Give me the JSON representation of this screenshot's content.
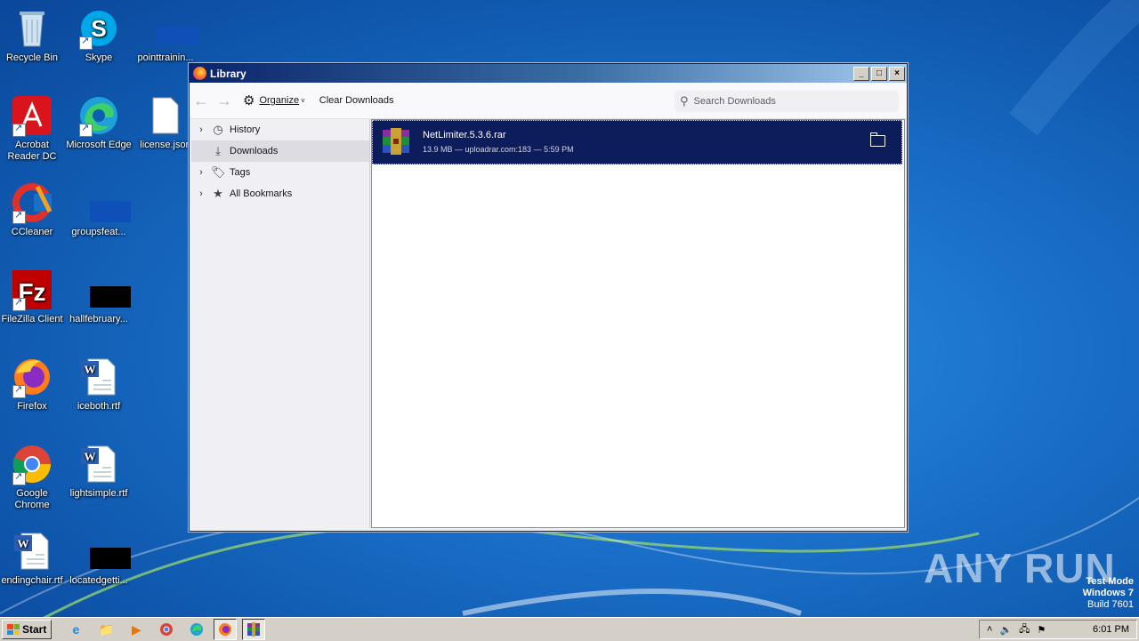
{
  "desktop": {
    "icons": [
      {
        "label": "Recycle Bin"
      },
      {
        "label": "Skype"
      },
      {
        "label": "pointtrainin..."
      },
      {
        "label": "Acrobat Reader DC"
      },
      {
        "label": "Microsoft Edge"
      },
      {
        "label": "license.json"
      },
      {
        "label": "CCleaner"
      },
      {
        "label": "groupsfeat..."
      },
      {
        "label": "FileZilla Client"
      },
      {
        "label": "hallfebruary..."
      },
      {
        "label": "Firefox"
      },
      {
        "label": "iceboth.rtf"
      },
      {
        "label": "Google Chrome"
      },
      {
        "label": "lightsimple.rtf"
      },
      {
        "label": "endingchair.rtf"
      },
      {
        "label": "locatedgetti..."
      }
    ]
  },
  "window": {
    "title": "Library",
    "toolbar": {
      "organize_label": "Organize",
      "clear_label": "Clear Downloads",
      "search_placeholder": "Search Downloads"
    },
    "sidebar": {
      "items": [
        {
          "label": "History",
          "icon": "clock-icon"
        },
        {
          "label": "Downloads",
          "icon": "download-icon"
        },
        {
          "label": "Tags",
          "icon": "tag-icon"
        },
        {
          "label": "All Bookmarks",
          "icon": "star-icon"
        }
      ]
    },
    "downloads": [
      {
        "name": "NetLimiter.5.3.6.rar",
        "meta": "13.9 MB — uploadrar.com:183 — 5:59 PM"
      }
    ]
  },
  "taskbar": {
    "start_label": "Start",
    "clock": "6:01 PM"
  },
  "watermark": {
    "line1": "Test Mode",
    "line2": "Windows 7",
    "line3": "Build 7601",
    "brand": "ANY RUN"
  }
}
